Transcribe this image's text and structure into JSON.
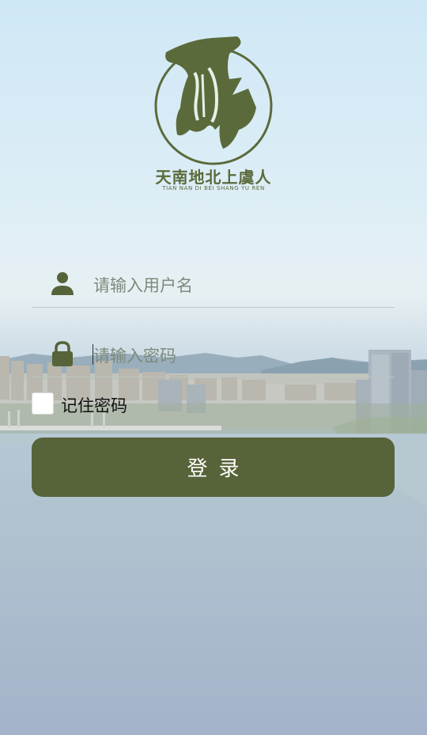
{
  "brand": {
    "name_cn": "天南地北上虞人",
    "name_en": "TIAN NAN DI BEI SHANG YU REN"
  },
  "form": {
    "username_placeholder": "请输入用户名",
    "password_placeholder": "请输入密码",
    "remember_label": "记住密码",
    "remember_checked": false,
    "login_label": "登录"
  },
  "icons": {
    "logo": "brand-logo",
    "username": "user-icon",
    "password": "lock-icon"
  },
  "colors": {
    "accent": "#576339",
    "brand_text": "#5a6a3a"
  }
}
